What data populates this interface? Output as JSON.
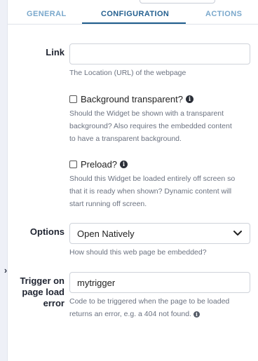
{
  "tabs": [
    {
      "label": "GENERAL",
      "active": false
    },
    {
      "label": "CONFIGURATION",
      "active": true
    },
    {
      "label": "ACTIONS",
      "active": false
    }
  ],
  "link": {
    "label": "Link",
    "value": "",
    "help": "The Location (URL) of the webpage"
  },
  "background_transparent": {
    "label": "Background transparent?",
    "checked": false,
    "help_lines": [
      "Should the Widget be shown with a transparent",
      "background? Also requires the embedded content",
      "to have a transparent background."
    ]
  },
  "preload": {
    "label": "Preload?",
    "checked": false,
    "help_lines": [
      "Should this Widget be loaded entirely off screen so",
      "that it is ready when shown? Dynamic content will",
      "start running off screen."
    ]
  },
  "options": {
    "label": "Options",
    "selected": "Open Natively",
    "help": "How should this web page be embedded?"
  },
  "trigger": {
    "label_lines": [
      "Trigger on",
      "page load",
      "error"
    ],
    "value": "mytrigger",
    "help_lines": [
      "Code to be triggered when the page to be loaded",
      "returns an error, e.g. a 404 not found."
    ]
  },
  "icons": {
    "info": "info-icon",
    "chevron_right": "chevron-right-icon",
    "chevron_down": "chevron-down-icon"
  },
  "colors": {
    "active_tab": "#246090",
    "inactive_tab": "#7aa8cc",
    "tab_underline": "#1f5d8c",
    "help_text": "#6b7280"
  }
}
